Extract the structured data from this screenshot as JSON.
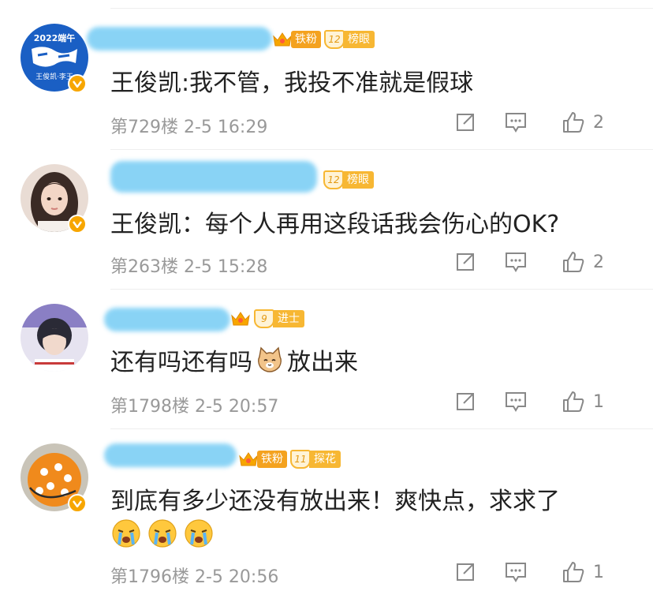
{
  "comments": [
    {
      "text": "王俊凯:我不管，我投不准就是假球",
      "floor": "第729楼",
      "time": "2-5 16:29",
      "likes": "2",
      "badges": {
        "crown_label": "铁粉",
        "level": "12",
        "level_label": "榜眼"
      },
      "avatar_text": {
        "line1": "2022端午",
        "line2": "王俊凯·李玉"
      }
    },
    {
      "text": "王俊凯：每个人再用这段话我会伤心的OK?",
      "floor": "第263楼",
      "time": "2-5 15:28",
      "likes": "2",
      "badges": {
        "level": "12",
        "level_label": "榜眼"
      }
    },
    {
      "text_before": "还有吗还有吗",
      "text_after": "放出来",
      "floor": "第1798楼",
      "time": "2-5 20:57",
      "likes": "1",
      "badges": {
        "level": "9",
        "level_label": "进士"
      }
    },
    {
      "text": "到底有多少还没有放出来！爽快点，求求了",
      "floor": "第1796楼",
      "time": "2-5 20:56",
      "likes": "1",
      "badges": {
        "crown_label": "铁粉",
        "level": "11",
        "level_label": "探花"
      }
    }
  ],
  "colors": {
    "accent": "#f7b733",
    "vip": "#f7a600",
    "meta": "#999999"
  },
  "icons": [
    "share-icon",
    "comment-icon",
    "like-icon",
    "verified-icon",
    "crown-icon",
    "cat-emoji-icon",
    "crying-emoji-icon"
  ]
}
